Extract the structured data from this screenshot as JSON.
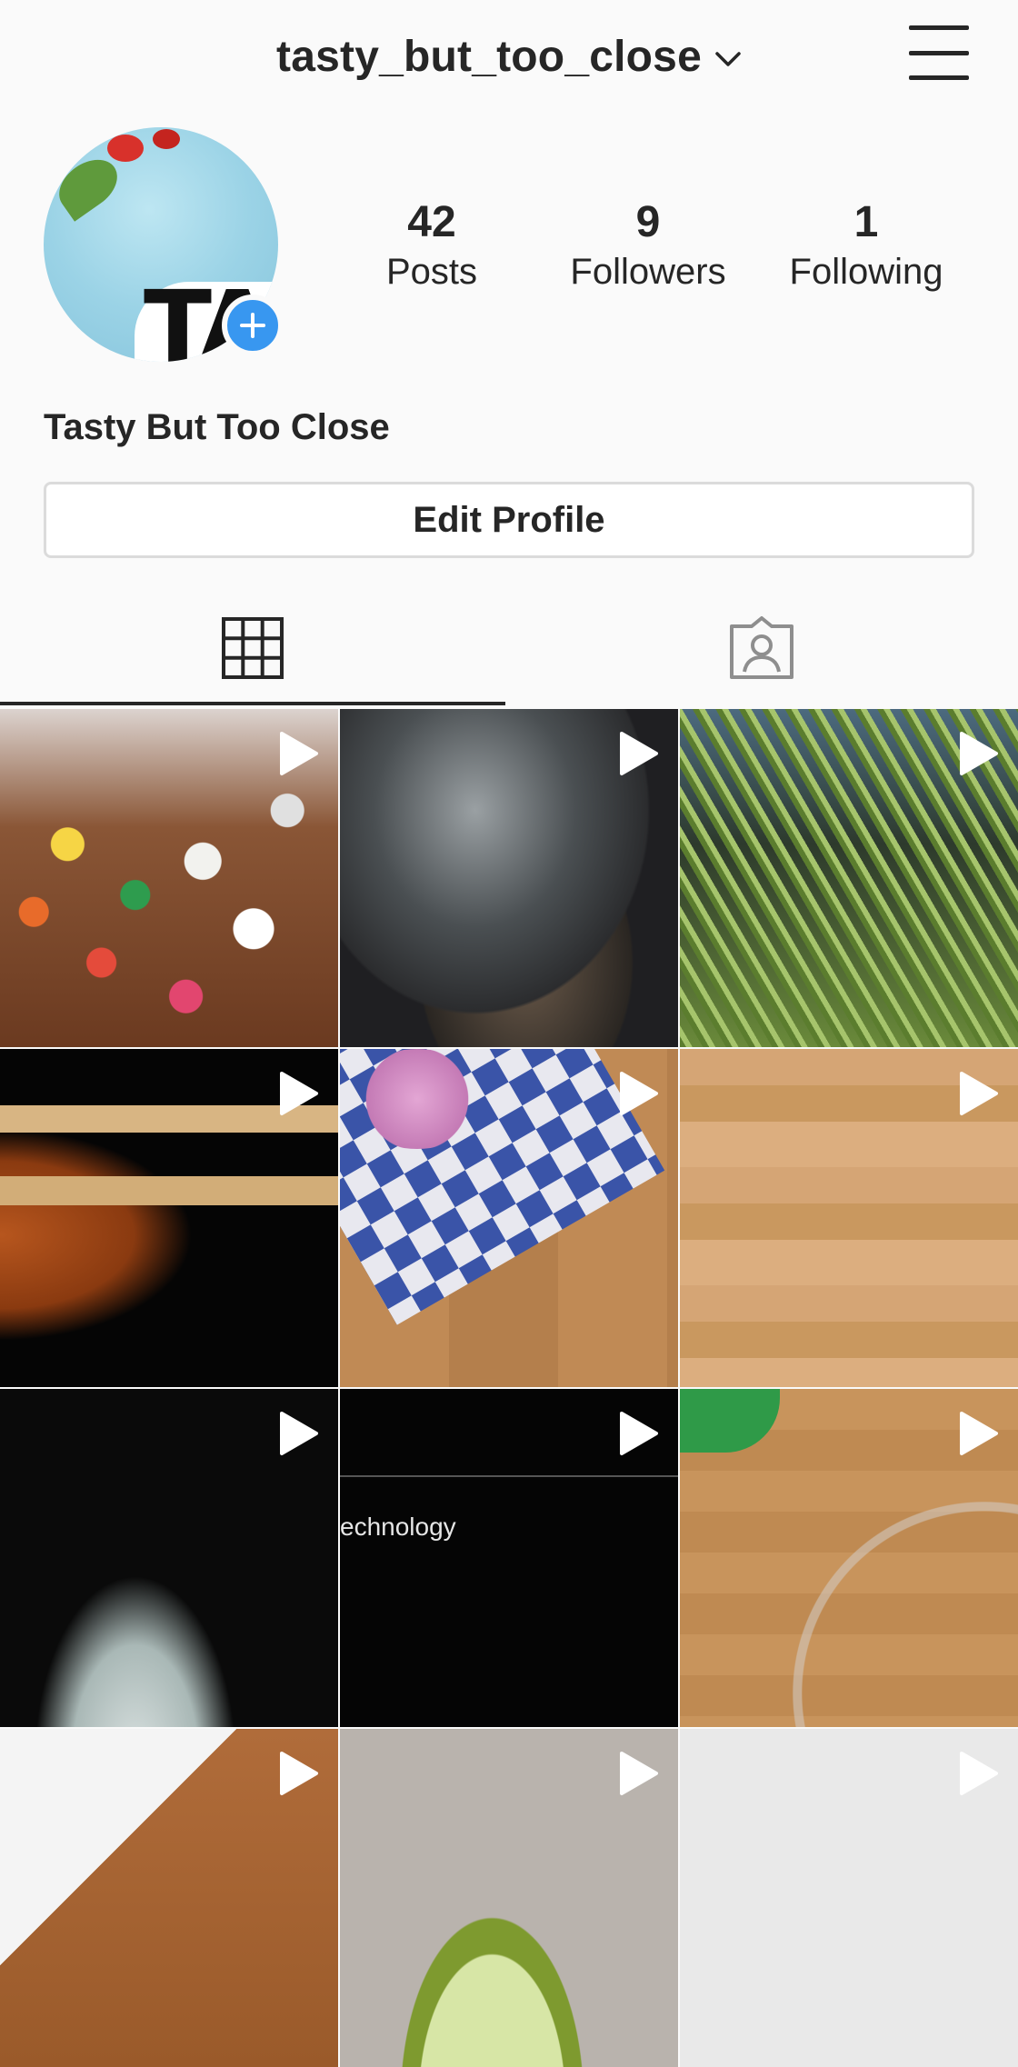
{
  "header": {
    "username": "tasty_but_too_close"
  },
  "profile": {
    "full_name": "Tasty But Too Close",
    "edit_button": "Edit Profile",
    "stats": [
      {
        "value": "42",
        "label": "Posts"
      },
      {
        "value": "9",
        "label": "Followers"
      },
      {
        "value": "1",
        "label": "Following"
      }
    ]
  },
  "tabs": [
    {
      "name": "grid",
      "icon": "grid-icon",
      "active": true
    },
    {
      "name": "tagged",
      "icon": "tagged-person-icon",
      "active": false
    }
  ],
  "posts": [
    {
      "type": "video"
    },
    {
      "type": "video"
    },
    {
      "type": "video"
    },
    {
      "type": "video"
    },
    {
      "type": "video"
    },
    {
      "type": "video"
    },
    {
      "type": "video"
    },
    {
      "type": "video",
      "caption": "echnology"
    },
    {
      "type": "video"
    },
    {
      "type": "video"
    },
    {
      "type": "video"
    },
    {
      "type": "video"
    }
  ],
  "colors": {
    "background": "#fafafa",
    "text": "#262626",
    "accent": "#3897f0",
    "border": "#dbdbdb"
  }
}
